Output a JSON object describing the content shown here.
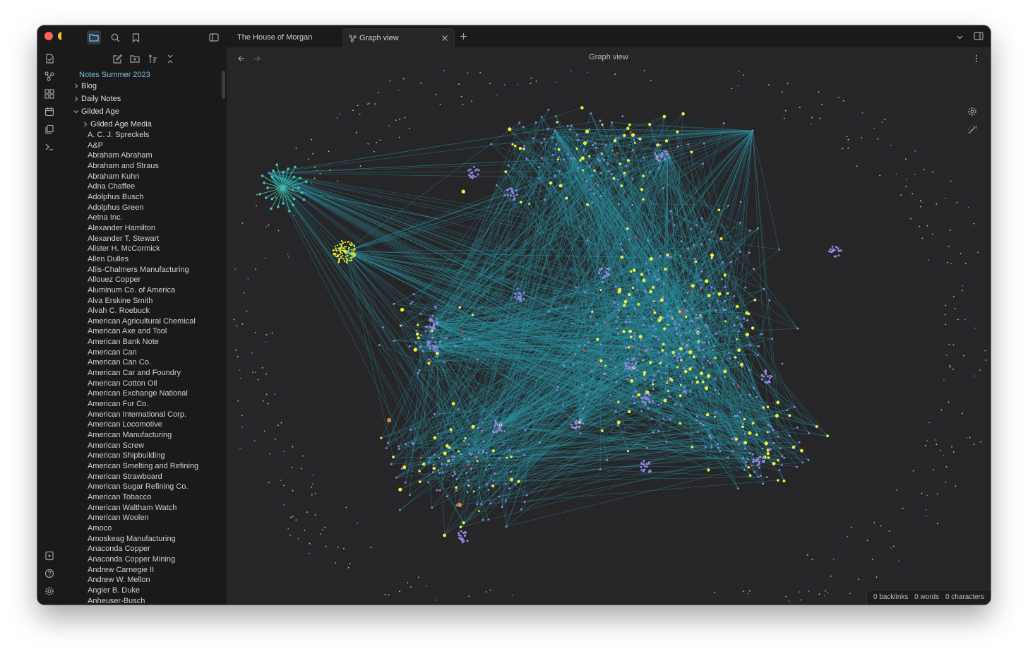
{
  "colors": {
    "accent": "#7fbddf",
    "node_yellow": "#e8f03a",
    "node_purple": "#8f86e0",
    "edge_teal": "#2a8fa0",
    "node_red": "#e2382c",
    "node_orange": "#e88a3a",
    "traffic_close": "#ff5f57",
    "traffic_min": "#febc2e",
    "traffic_max": "#28c840"
  },
  "ribbon": {
    "icons": [
      "files-icon",
      "search-icon",
      "bookmark-icon",
      "sidebar-toggle-icon"
    ],
    "left_icons": [
      "open-note-icon",
      "graph-icon",
      "canvas-icon",
      "calendar-icon",
      "copy-icon",
      "terminal-icon"
    ],
    "bottom_icons": [
      "vault-switch-icon",
      "help-icon",
      "settings-icon"
    ]
  },
  "sidebar": {
    "vault_name": "Notes Summer 2023",
    "folders": [
      {
        "label": "Blog",
        "expanded": false
      },
      {
        "label": "Daily Notes",
        "expanded": false
      },
      {
        "label": "Gilded Age",
        "expanded": true
      }
    ],
    "subfolder": "Gilded Age Media",
    "files": [
      "A. C. J. Spreckels",
      "A&P",
      "Abraham Abraham",
      "Abraham and Straus",
      "Abraham Kuhn",
      "Adna Chaffee",
      "Adolphus Busch",
      "Adolphus Green",
      "Aetna Inc.",
      "Alexander Hamilton",
      "Alexander T. Stewart",
      "Alister H. McCormick",
      "Allen Dulles",
      "Allis-Chalmers Manufacturing",
      "Allouez Copper",
      "Aluminum Co. of America",
      "Alva Erskine Smith",
      "Alvah C. Roebuck",
      "American Agricultural Chemical",
      "American Axe and Tool",
      "American Bank Note",
      "American Can",
      "American Can Co.",
      "American Car and Foundry",
      "American Cotton Oil",
      "American Exchange National",
      "American Fur Co.",
      "American International Corp.",
      "American Locomotive",
      "American Manufacturing",
      "American Screw",
      "American Shipbuilding",
      "American Smelting and Refining",
      "American Strawboard",
      "American Sugar Refining Co.",
      "American Tobacco",
      "American Waltham Watch",
      "American Woolen",
      "Amoco",
      "Amoskeag Manufacturing",
      "Anaconda Copper",
      "Anaconda Copper Mining",
      "Andrew Carnegie II",
      "Andrew W. Mellon",
      "Angier B. Duke",
      "Anheuser-Busch"
    ]
  },
  "tabs": [
    {
      "label": "The House of Morgan",
      "active": false
    },
    {
      "label": "Graph view",
      "active": true
    }
  ],
  "pane": {
    "title": "Graph view"
  },
  "status": {
    "backlinks": "0 backlinks",
    "words": "0 words",
    "characters": "0 characters"
  }
}
